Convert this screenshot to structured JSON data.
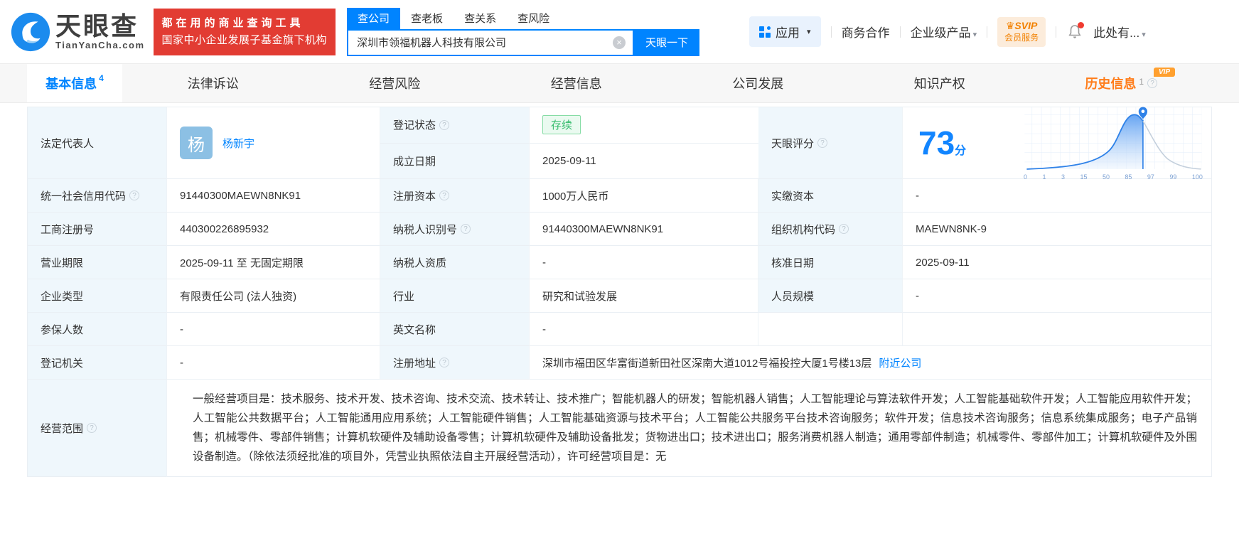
{
  "accent": "#0084ff",
  "icons": {
    "clear": "×",
    "caret": "▾",
    "help": "?",
    "crown": "♛"
  },
  "header": {
    "brand": "天眼查",
    "brand_domain": "TianYanCha.com",
    "promo_line1": "都在用的商业查询工具",
    "promo_line2": "国家中小企业发展子基金旗下机构",
    "search_tabs": [
      {
        "label": "查公司"
      },
      {
        "label": "查老板"
      },
      {
        "label": "查关系"
      },
      {
        "label": "查风险"
      }
    ],
    "search_value": "深圳市领福机器人科技有限公司",
    "search_button": "天眼一下",
    "nav_apps": "应用",
    "nav_cooperation": "商务合作",
    "nav_enterprise": "企业级产品",
    "svip_top": "SVIP",
    "svip_bottom": "会员服务",
    "nav_user": "此处有..."
  },
  "tabs": {
    "basic": {
      "label": "基本信息",
      "count": "4"
    },
    "legal": {
      "label": "法律诉讼"
    },
    "risk": {
      "label": "经营风险"
    },
    "operation": {
      "label": "经营信息"
    },
    "development": {
      "label": "公司发展"
    },
    "ip": {
      "label": "知识产权"
    },
    "history": {
      "label": "历史信息",
      "count": "1",
      "vip": "VIP"
    }
  },
  "basic": {
    "legal_rep": {
      "label": "法定代表人",
      "avatar": "杨",
      "name": "杨新宇"
    },
    "reg_status": {
      "label": "登记状态",
      "value": "存续"
    },
    "establish_date": {
      "label": "成立日期",
      "value": "2025-09-11"
    },
    "score": {
      "label": "天眼评分",
      "value": "73",
      "unit": "分",
      "axis": [
        "0",
        "1",
        "3",
        "15",
        "50",
        "85",
        "97",
        "99",
        "100"
      ]
    },
    "rows": [
      {
        "cells": [
          {
            "label": "统一社会信用代码",
            "value": "91440300MAEWN8NK91"
          },
          {
            "label": "注册资本",
            "value": "1000万人民币"
          },
          {
            "label": "实缴资本",
            "value": "-"
          }
        ]
      },
      {
        "cells": [
          {
            "label": "工商注册号",
            "value": "440300226895932"
          },
          {
            "label": "纳税人识别号",
            "value": "91440300MAEWN8NK91"
          },
          {
            "label": "组织机构代码",
            "value": "MAEWN8NK-9"
          }
        ]
      },
      {
        "cells": [
          {
            "label": "营业期限",
            "value": "2025-09-11 至 无固定期限"
          },
          {
            "label": "纳税人资质",
            "value": "-"
          },
          {
            "label": "核准日期",
            "value": "2025-09-11"
          }
        ]
      },
      {
        "cells": [
          {
            "label": "企业类型",
            "value": "有限责任公司 (法人独资)"
          },
          {
            "label": "行业",
            "value": "研究和试验发展"
          },
          {
            "label": "人员规模",
            "value": "-"
          }
        ]
      },
      {
        "cells": [
          {
            "label": "参保人数",
            "value": "-"
          },
          {
            "label": "英文名称",
            "value": "-"
          },
          {
            "label": "",
            "value": ""
          }
        ]
      }
    ],
    "reg_authority": {
      "label": "登记机关",
      "value": "-"
    },
    "reg_address": {
      "label": "注册地址",
      "value": "深圳市福田区华富街道新田社区深南大道1012号福投控大厦1号楼13层",
      "link": "附近公司"
    },
    "business_scope": {
      "label": "经营范围",
      "value": "一般经营项目是：技术服务、技术开发、技术咨询、技术交流、技术转让、技术推广；智能机器人的研发；智能机器人销售；人工智能理论与算法软件开发；人工智能基础软件开发；人工智能应用软件开发；人工智能公共数据平台；人工智能通用应用系统；人工智能硬件销售；人工智能基础资源与技术平台；人工智能公共服务平台技术咨询服务；软件开发；信息技术咨询服务；信息系统集成服务；电子产品销售；机械零件、零部件销售；计算机软硬件及辅助设备零售；计算机软硬件及辅助设备批发；货物进出口；技术进出口；服务消费机器人制造；通用零部件制造；机械零件、零部件加工；计算机软硬件及外围设备制造。（除依法须经批准的项目外，凭营业执照依法自主开展经营活动），许可经营项目是：无"
    }
  }
}
